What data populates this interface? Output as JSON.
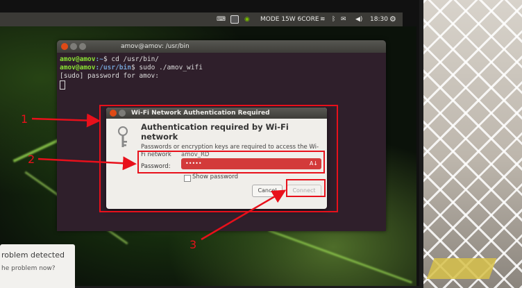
{
  "topbar": {
    "nvidia_mode": "MODE 15W 6CORE",
    "clock": "18:30",
    "icons": [
      "keyboard-icon",
      "m-indicator-icon",
      "nvidia-icon",
      "wifi-icon",
      "bluetooth-icon",
      "mail-icon",
      "volume-icon",
      "gear-icon"
    ]
  },
  "terminal": {
    "title": "amov@amov: /usr/bin",
    "lines": [
      {
        "user": "amov@amov",
        "path": ":~",
        "cmd": "$ cd /usr/bin/"
      },
      {
        "user": "amov@amov",
        "path": ":/usr/bin",
        "cmd": "$ sudo ./amov_wifi"
      }
    ],
    "prompt_line": "[sudo] password for amov:"
  },
  "dialog": {
    "title": "Wi-Fi Network Authentication Required",
    "heading": "Authentication required by Wi-Fi network",
    "description": "Passwords or encryption keys are required to access the Wi-",
    "network_label": "Fi network",
    "network_value": "amov_RD",
    "password_label": "Password:",
    "password_value": "•••••",
    "show_password_label": "Show password",
    "show_password_checked": false,
    "cancel_label": "Cancel",
    "connect_label": "Connect",
    "error_color": "#d33a3a"
  },
  "problem_dialog": {
    "title": "roblem detected",
    "subtitle": "he problem now?"
  },
  "annotations": {
    "labels": [
      "1",
      "2",
      "3"
    ],
    "color": "#e8101b"
  }
}
